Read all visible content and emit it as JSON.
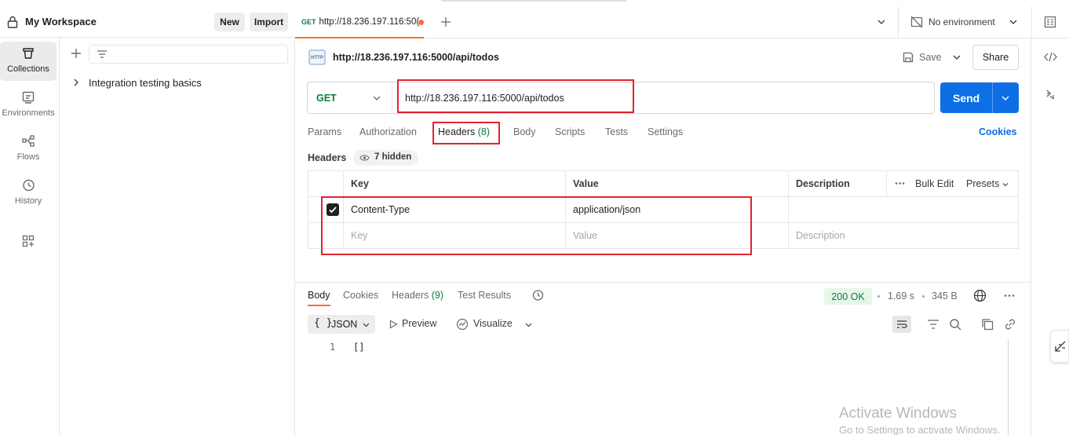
{
  "workspace": {
    "title": "My Workspace",
    "new_label": "New",
    "import_label": "Import"
  },
  "nav": {
    "items": [
      {
        "label": "Collections",
        "icon": "collections-icon",
        "active": true
      },
      {
        "label": "Environments",
        "icon": "environments-icon",
        "active": false
      },
      {
        "label": "Flows",
        "icon": "flows-icon",
        "active": false
      },
      {
        "label": "History",
        "icon": "history-icon",
        "active": false
      }
    ]
  },
  "collections": {
    "items": [
      {
        "label": "Integration testing basics"
      }
    ]
  },
  "tabbar": {
    "tab_method": "GET",
    "tab_url": "http://18.236.197.116:50(",
    "environment": "No environment"
  },
  "request": {
    "title": "http://18.236.197.116:5000/api/todos",
    "save_label": "Save",
    "share_label": "Share",
    "method": "GET",
    "url": "http://18.236.197.116:5000/api/todos",
    "send_label": "Send"
  },
  "request_tabs": {
    "params": "Params",
    "authorization": "Authorization",
    "headers": "Headers",
    "headers_count": "(8)",
    "body": "Body",
    "scripts": "Scripts",
    "tests": "Tests",
    "settings": "Settings",
    "cookies": "Cookies"
  },
  "headers": {
    "section_label": "Headers",
    "hidden_label": "7 hidden",
    "columns": {
      "key": "Key",
      "value": "Value",
      "description": "Description"
    },
    "bulk_edit": "Bulk Edit",
    "presets": "Presets",
    "rows": [
      {
        "key": "Content-Type",
        "value": "application/json",
        "description": "",
        "checked": true
      }
    ],
    "placeholder": {
      "key": "Key",
      "value": "Value",
      "description": "Description"
    }
  },
  "response": {
    "tabs": {
      "body": "Body",
      "cookies": "Cookies",
      "headers": "Headers",
      "headers_count": "(9)",
      "test_results": "Test Results"
    },
    "status": "200 OK",
    "time": "1.69 s",
    "size": "345 B",
    "format": "JSON",
    "format_braces": "{ }",
    "preview": "Preview",
    "visualize": "Visualize",
    "line_number": "1",
    "body_text": "[]"
  },
  "watermark": {
    "line1": "Activate Windows",
    "line2": "Go to Settings to activate Windows."
  },
  "colors": {
    "accent_orange": "#ff6c37",
    "send_blue": "#0d6ee6",
    "method_green": "#0f7a3d",
    "annotation_red": "#e0242f"
  }
}
